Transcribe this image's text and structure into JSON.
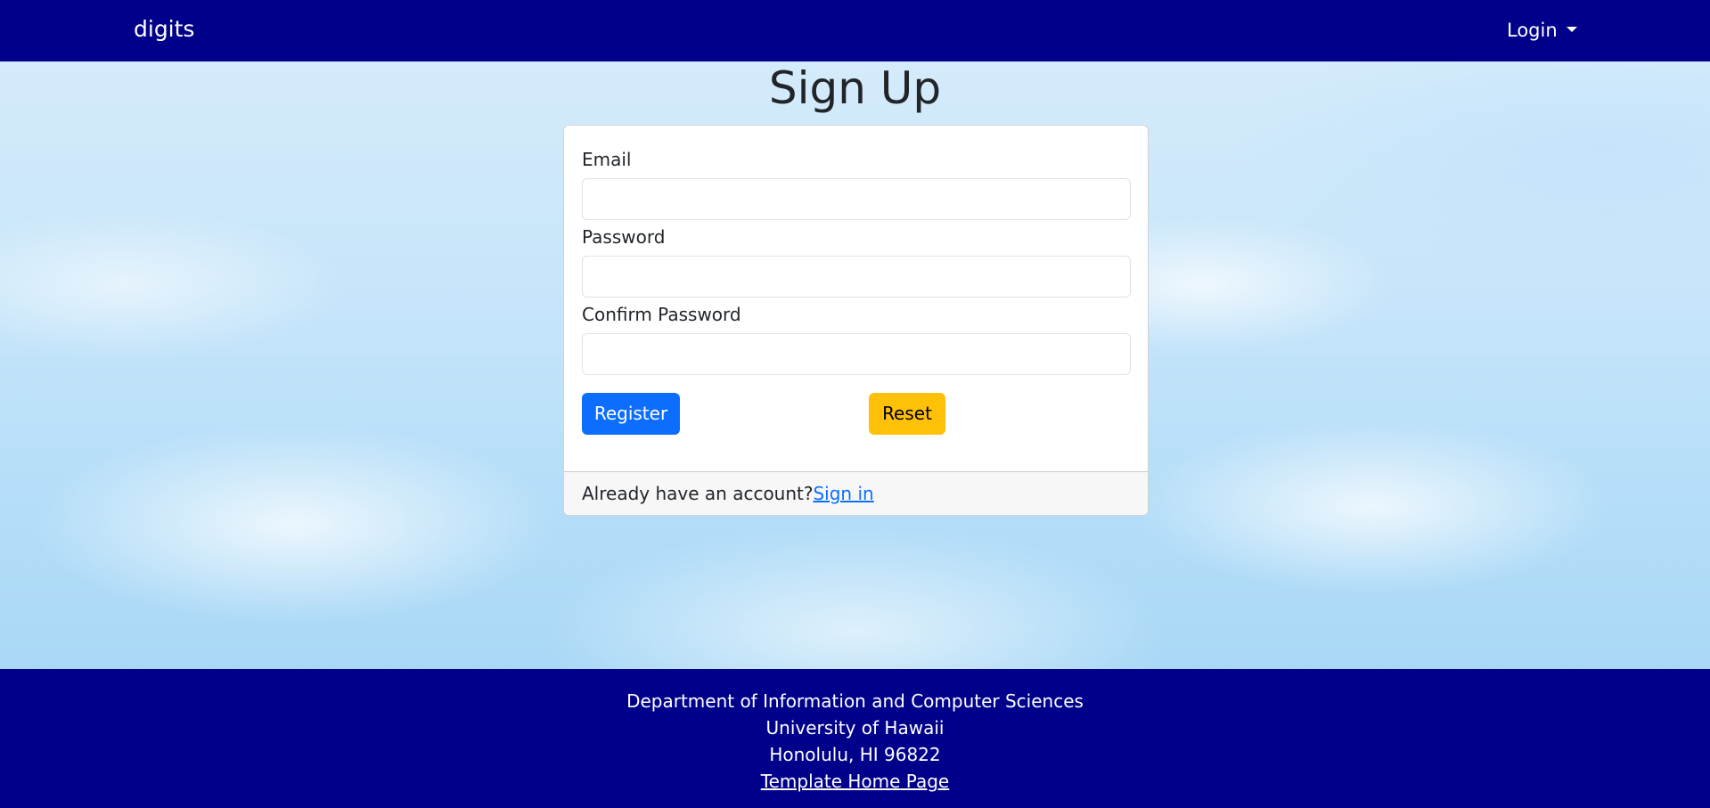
{
  "navbar": {
    "brand": "digits",
    "login_label": "Login"
  },
  "page": {
    "title": "Sign Up"
  },
  "form": {
    "email_label": "Email",
    "email_value": "",
    "password_label": "Password",
    "password_value": "",
    "confirm_label": "Confirm Password",
    "confirm_value": "",
    "register_label": "Register",
    "reset_label": "Reset",
    "footer_text": "Already have an account?",
    "signin_label": "Sign in"
  },
  "footer": {
    "line1": "Department of Information and Computer Sciences",
    "line2": "University of Hawaii",
    "line3": "Honolulu, HI 96822",
    "link_label": "Template Home Page"
  },
  "colors": {
    "navbar_bg": "#00008b",
    "primary": "#0d6efd",
    "warning": "#ffc107"
  },
  "icons": {
    "login_dropdown": "caret-down-icon"
  }
}
